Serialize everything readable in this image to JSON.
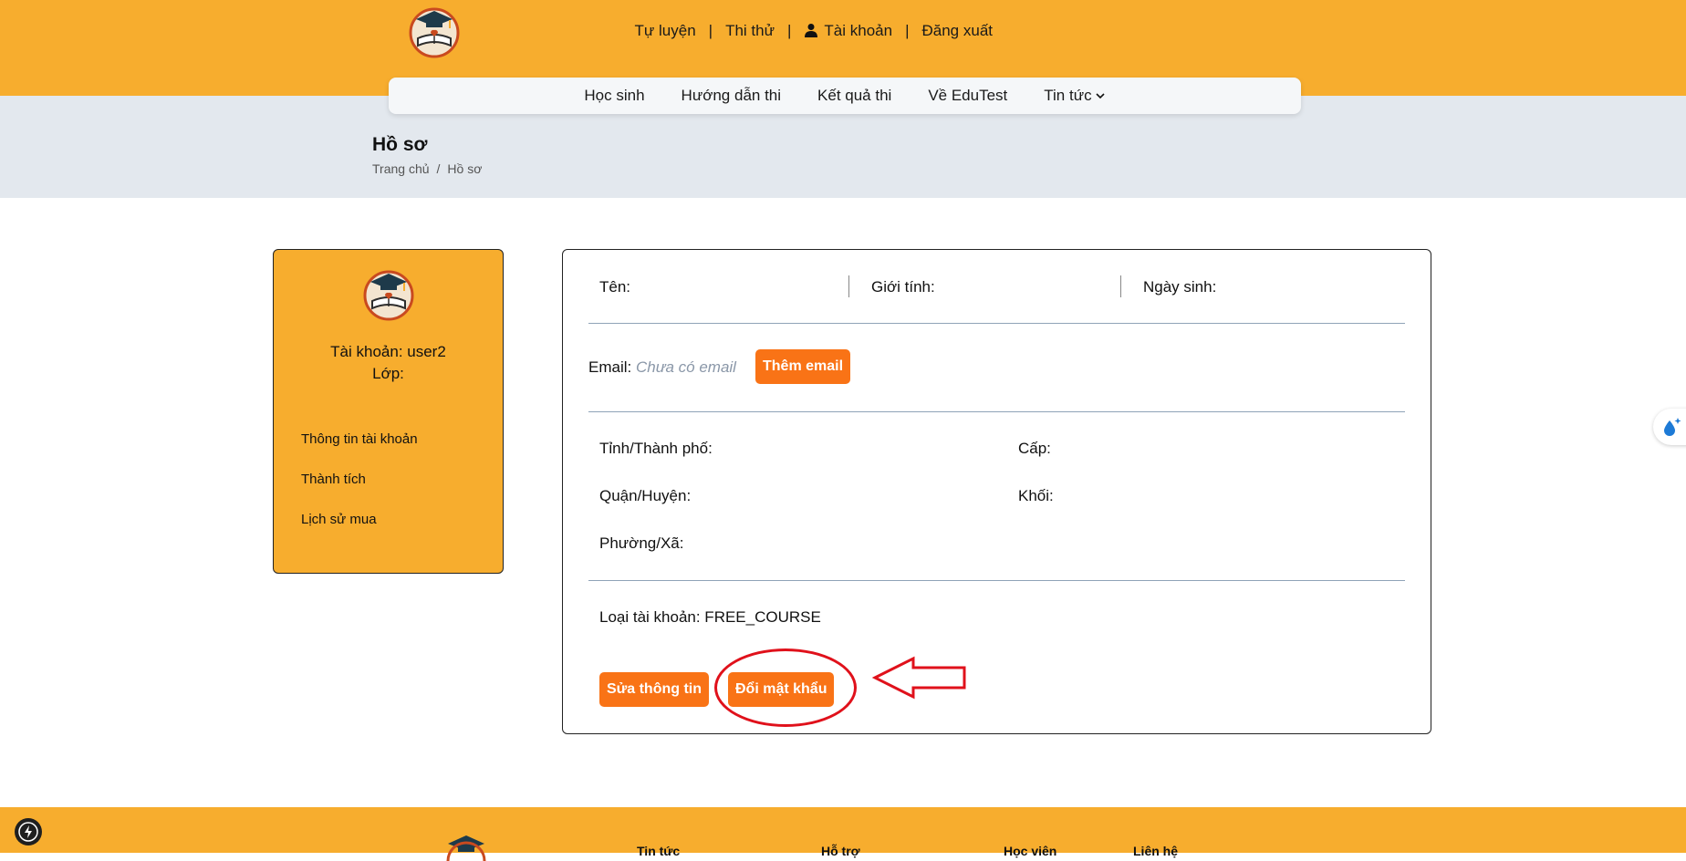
{
  "header": {
    "links": [
      "Tự luyện",
      "Thi thử",
      "Tài khoản",
      "Đăng xuất"
    ],
    "separator": "|"
  },
  "nav": {
    "items": [
      "Học sinh",
      "Hướng dẫn thi",
      "Kết quả thi",
      "Về EduTest",
      "Tin tức"
    ]
  },
  "page": {
    "title": "Hồ sơ",
    "breadcrumb": [
      "Trang chủ",
      "/",
      "Hồ sơ"
    ]
  },
  "sidebar": {
    "account": "Tài khoản: user2",
    "class": "Lớp:",
    "menu": [
      "Thông tin tài khoản",
      "Thành tích",
      "Lịch sử mua"
    ]
  },
  "profile": {
    "name_label": "Tên:",
    "gender_label": "Giới tính:",
    "dob_label": "Ngày sinh:",
    "email_label": "Email:",
    "email_placeholder": "Chưa có email",
    "add_email_button": "Thêm email",
    "province_label": "Tỉnh/Thành phố:",
    "level_label": "Cấp:",
    "district_label": "Quận/Huyện:",
    "grade_label": "Khối:",
    "ward_label": "Phường/Xã:",
    "account_type": "Loại tài khoản: FREE_COURSE",
    "edit_button": "Sửa thông tin",
    "change_password_button": "Đổi mật khẩu"
  },
  "footer": {
    "columns": [
      "Tin tức",
      "Hỗ trợ",
      "Học viên",
      "Liên hệ"
    ]
  },
  "colors": {
    "brand_orange": "#f7ad2e",
    "button_orange": "#f97316",
    "annotation_red": "#e0111b"
  }
}
